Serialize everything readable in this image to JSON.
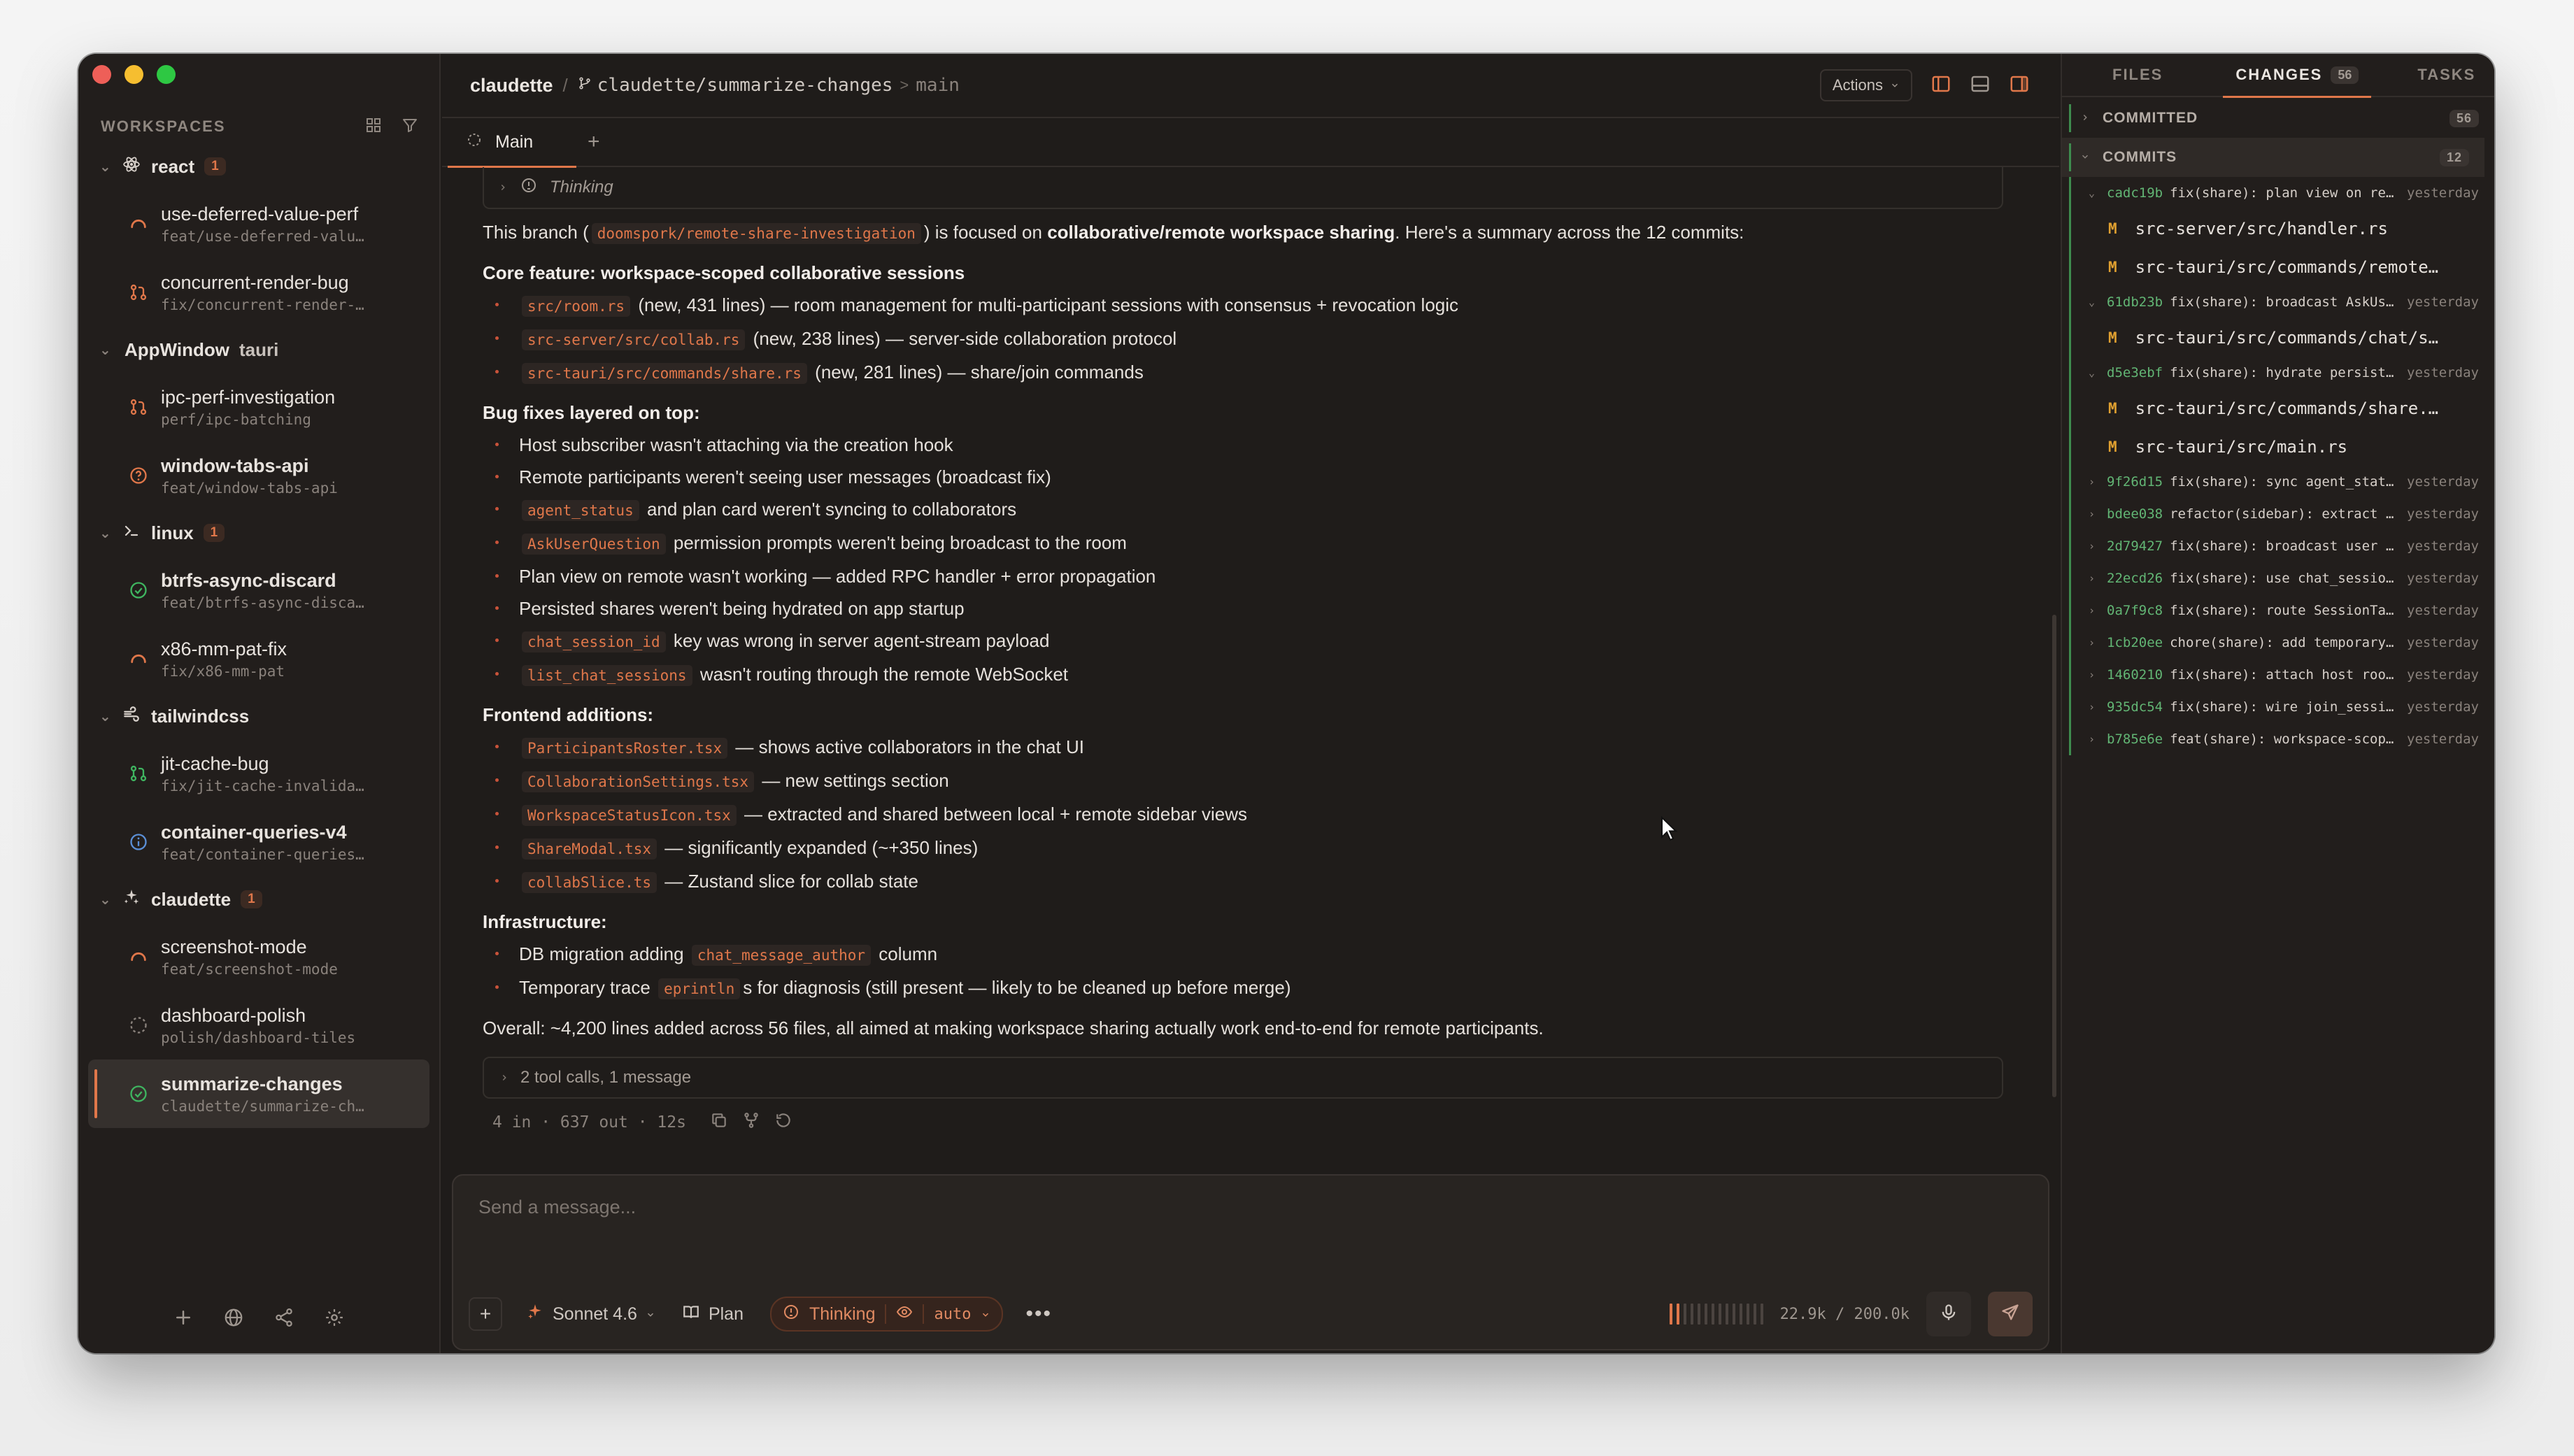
{
  "sidebar": {
    "title": "WORKSPACES",
    "groups": [
      {
        "name": "react",
        "badge": "1",
        "items": [
          {
            "name": "use-deferred-value-perf",
            "branch": "feat/use-deferred-valu…"
          },
          {
            "name": "concurrent-render-bug",
            "branch": "fix/concurrent-render-…"
          }
        ]
      },
      {
        "name": "AppWindow",
        "tag": "tauri",
        "items": [
          {
            "name": "ipc-perf-investigation",
            "branch": "perf/ipc-batching"
          },
          {
            "name": "window-tabs-api",
            "branch": "feat/window-tabs-api"
          }
        ]
      },
      {
        "name": "linux",
        "badge": "1",
        "items": [
          {
            "name": "btrfs-async-discard",
            "branch": "feat/btrfs-async-disca…"
          },
          {
            "name": "x86-mm-pat-fix",
            "branch": "fix/x86-mm-pat"
          }
        ]
      },
      {
        "name": "tailwindcss",
        "items": [
          {
            "name": "jit-cache-bug",
            "branch": "fix/jit-cache-invalida…"
          },
          {
            "name": "container-queries-v4",
            "branch": "feat/container-queries…"
          }
        ]
      },
      {
        "name": "claudette",
        "badge": "1",
        "items": [
          {
            "name": "screenshot-mode",
            "branch": "feat/screenshot-mode"
          },
          {
            "name": "dashboard-polish",
            "branch": "polish/dashboard-tiles"
          },
          {
            "name": "summarize-changes",
            "branch": "claudette/summarize-ch…"
          }
        ]
      }
    ]
  },
  "header": {
    "project": "claudette",
    "sep": "/",
    "branch": "claudette/summarize-changes",
    "gt": ">",
    "base": "main",
    "actions": "Actions"
  },
  "tabs": {
    "main": "Main"
  },
  "message": {
    "thinking": "Thinking",
    "intro_pre": "This branch (",
    "intro_code": "doomspork/remote-share-investigation",
    "intro_mid": ") is focused on ",
    "intro_bold": "collaborative/remote workspace sharing",
    "intro_post": ". Here's a summary across the 12 commits:",
    "core_title": "Core feature: workspace-scoped collaborative sessions",
    "core": [
      {
        "code": "src/room.rs",
        "text": "(new, 431 lines) — room management for multi-participant sessions with consensus + revocation logic"
      },
      {
        "code": "src-server/src/collab.rs",
        "text": "(new, 238 lines) — server-side collaboration protocol"
      },
      {
        "code": "src-tauri/src/commands/share.rs",
        "text": "(new, 281 lines) — share/join commands"
      }
    ],
    "bugs_title": "Bug fixes layered on top:",
    "bug1": "Host subscriber wasn't attaching via the creation hook",
    "bug2": "Remote participants weren't seeing user messages (broadcast fix)",
    "bug3_code": "agent_status",
    "bug3_text": "and plan card weren't syncing to collaborators",
    "bug4_code": "AskUserQuestion",
    "bug4_text": "permission prompts weren't being broadcast to the room",
    "bug5": "Plan view on remote wasn't working — added RPC handler + error propagation",
    "bug6": "Persisted shares weren't being hydrated on app startup",
    "bug7_code": "chat_session_id",
    "bug7_text": "key was wrong in server agent-stream payload",
    "bug8_code": "list_chat_sessions",
    "bug8_text": "wasn't routing through the remote WebSocket",
    "frontend_title": "Frontend additions:",
    "frontend": [
      {
        "code": "ParticipantsRoster.tsx",
        "text": "— shows active collaborators in the chat UI"
      },
      {
        "code": "CollaborationSettings.tsx",
        "text": "— new settings section"
      },
      {
        "code": "WorkspaceStatusIcon.tsx",
        "text": "— extracted and shared between local + remote sidebar views"
      },
      {
        "code": "ShareModal.tsx",
        "text": "— significantly expanded (~+350 lines)"
      },
      {
        "code": "collabSlice.ts",
        "text": "— Zustand slice for collab state"
      }
    ],
    "infra_title": "Infrastructure:",
    "infra1_pre": "DB migration adding",
    "infra1_code": "chat_message_author",
    "infra1_post": "column",
    "infra2_pre": "Temporary trace",
    "infra2_code": "eprintln",
    "infra2_post": "s for diagnosis (still present — likely to be cleaned up before merge)",
    "overall": "Overall: ~4,200 lines added across 56 files, all aimed at making workspace sharing actually work end-to-end for remote participants.",
    "toolcalls": "2 tool calls, 1 message",
    "stats": "4 in · 637 out · 12s"
  },
  "composer": {
    "placeholder": "Send a message...",
    "model": "Sonnet 4.6",
    "plan": "Plan",
    "thinking": "Thinking",
    "auto": "auto",
    "tokens": "22.9k / 200.0k",
    "meter_fill": 0.11
  },
  "right": {
    "tabs": {
      "files": "FILES",
      "changes": "CHANGES",
      "changes_count": "56",
      "tasks": "TASKS"
    },
    "committed": "COMMITTED",
    "committed_count": "56",
    "commits_label": "COMMITS",
    "commits_count": "12",
    "commits": [
      {
        "hash": "cadc19b",
        "msg": "fix(share): plan view on remot…",
        "time": "yesterday",
        "open": true,
        "files": [
          "src-server/src/handler.rs",
          "src-tauri/src/commands/remote…"
        ]
      },
      {
        "hash": "61db23b",
        "msg": "fix(share): broadcast AskUser…",
        "time": "yesterday",
        "open": true,
        "files": [
          "src-tauri/src/commands/chat/s…"
        ]
      },
      {
        "hash": "d5e3ebf",
        "msg": "fix(share): hydrate persisted s…",
        "time": "yesterday",
        "open": true,
        "files": [
          "src-tauri/src/commands/share.…",
          "src-tauri/src/main.rs"
        ]
      },
      {
        "hash": "9f26d15",
        "msg": "fix(share): sync agent_status …",
        "time": "yesterday"
      },
      {
        "hash": "bdee038",
        "msg": "refactor(sidebar): extract Wor…",
        "time": "yesterday"
      },
      {
        "hash": "2d79427",
        "msg": "fix(share): broadcast user me…",
        "time": "yesterday"
      },
      {
        "hash": "22ecd26",
        "msg": "fix(share): use chat_session_i…",
        "time": "yesterday"
      },
      {
        "hash": "0a7f9c8",
        "msg": "fix(share): route SessionTabs.l…",
        "time": "yesterday"
      },
      {
        "hash": "1cb20ee",
        "msg": "chore(share): add temporary …",
        "time": "yesterday"
      },
      {
        "hash": "1460210",
        "msg": "fix(share): attach host room s…",
        "time": "yesterday"
      },
      {
        "hash": "935dc54",
        "msg": "fix(share): wire join_session, h…",
        "time": "yesterday"
      },
      {
        "hash": "b785e6e",
        "msg": "feat(share): workspace-scop…",
        "time": "yesterday"
      }
    ],
    "file_status": "M"
  },
  "colors": {
    "accent": "#e0774a",
    "green": "#3e8c4e",
    "bg": "#1f1c1a"
  }
}
